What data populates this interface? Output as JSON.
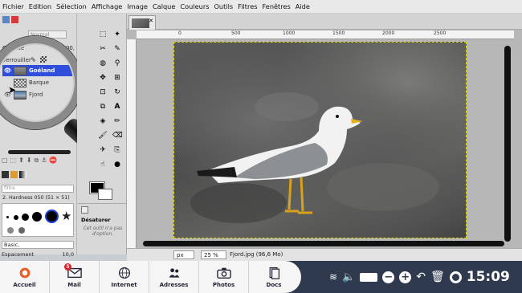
{
  "menu": [
    "Fichier",
    "Edition",
    "Sélection",
    "Affichage",
    "Image",
    "Calque",
    "Couleurs",
    "Outils",
    "Filtres",
    "Fenêtres",
    "Aide"
  ],
  "layers_panel": {
    "mode_field": "Normal",
    "opacity_label": "Opacité",
    "opacity_value": "100,",
    "lock_label": "Verrouiller :",
    "layers": [
      {
        "name": "Goéland",
        "selected": true
      },
      {
        "name": "Barque",
        "selected": false
      },
      {
        "name": "Fjord",
        "selected": false
      }
    ]
  },
  "brushes_panel": {
    "filter_placeholder": "filtre",
    "brush_name": "2. Hardness 050 (51 × 51)",
    "preset": "Basic,",
    "spacing_label": "Espacement",
    "spacing_value": "10,0"
  },
  "tool_options": {
    "title": "Désaturer",
    "message": "Cet outil n'a pas d'option."
  },
  "ruler": [
    "0",
    "500",
    "1000",
    "1500",
    "2000",
    "2500"
  ],
  "status": {
    "unit": "px",
    "zoom": "25 %",
    "file_info": "Fjord.jpg (96,6 Mo)"
  },
  "dock": [
    {
      "label": "Accueil",
      "icon": "home-icon"
    },
    {
      "label": "Mail",
      "icon": "mail-icon",
      "badge": "5"
    },
    {
      "label": "Internet",
      "icon": "globe-icon"
    },
    {
      "label": "Adresses",
      "icon": "contacts-icon"
    },
    {
      "label": "Photos",
      "icon": "camera-icon"
    },
    {
      "label": "Docs",
      "icon": "documents-icon"
    }
  ],
  "tray": {
    "time": "15:09"
  },
  "colors": {
    "taskbar": "#2f3a4e",
    "layer_selected": "#1e3fd9",
    "dock_bg": "#f5f5f5"
  }
}
